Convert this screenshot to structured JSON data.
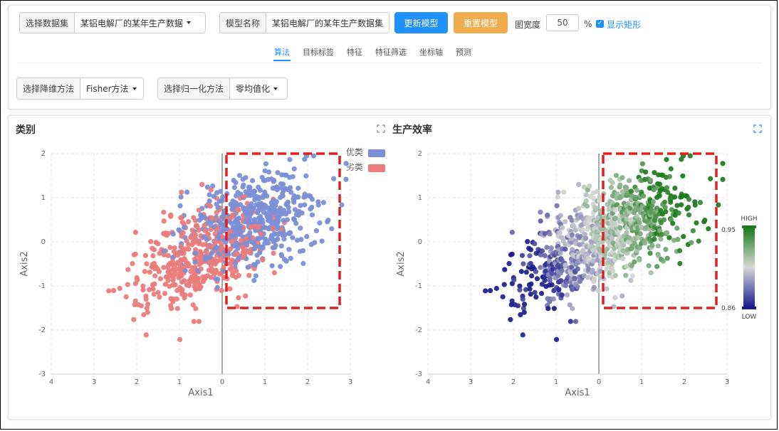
{
  "toolbar": {
    "dataset_label": "选择数据集",
    "dataset_value": "某铝电解厂的某年生产数据",
    "model_label": "模型名称",
    "model_value": "某铝电解厂的某年生产数据集",
    "update_button": "更新模型",
    "reset_button": "重置模型",
    "width_label": "图宽度",
    "width_value": "50",
    "width_unit": "%",
    "show_rect_label": "显示矩形",
    "show_rect_checked": true
  },
  "tabs": [
    {
      "label": "算法",
      "active": true
    },
    {
      "label": "目标标签",
      "active": false
    },
    {
      "label": "特征",
      "active": false
    },
    {
      "label": "特征筛选",
      "active": false
    },
    {
      "label": "坐标轴",
      "active": false
    },
    {
      "label": "预测",
      "active": false
    }
  ],
  "options": {
    "reduction_label": "选择降维方法",
    "reduction_value": "Fisher方法",
    "normalize_label": "选择归一化方法",
    "normalize_value": "零均值化"
  },
  "colors": {
    "accent": "#1e90ff",
    "reset": "#f0ad4e",
    "class_good": "#7b8fd6",
    "class_bad": "#ec7b7b",
    "rect": "#e02020",
    "scale_high": "#1a7a1a",
    "scale_mid": "#d8d8d8",
    "scale_low": "#1a1a8c"
  },
  "chart_data": [
    {
      "type": "scatter",
      "title": "类别",
      "xlabel": "Axis1",
      "ylabel": "Axis2",
      "xlim": [
        -4,
        3
      ],
      "ylim": [
        -3,
        2
      ],
      "x_ticks": [
        "4",
        "3",
        "2",
        "1",
        "0",
        "1",
        "2",
        "3"
      ],
      "y_ticks": [
        "2",
        "1",
        "0",
        "-1",
        "-2",
        "-3"
      ],
      "grid": true,
      "legend_position": "top-right",
      "series": [
        {
          "name": "优类",
          "color": "#7b8fd6",
          "count": 520,
          "center": [
            0.7,
            0.5
          ],
          "spread": [
            0.75,
            0.55
          ],
          "correlation": 0.35
        },
        {
          "name": "劣类",
          "color": "#ec7b7b",
          "count": 430,
          "center": [
            -0.6,
            -0.3
          ],
          "spread": [
            0.8,
            0.6
          ],
          "correlation": 0.45
        }
      ],
      "highlight_rect": {
        "x": [
          0.1,
          2.75
        ],
        "y": [
          -1.5,
          2.0
        ],
        "color": "#e02020",
        "dashed": true
      }
    },
    {
      "type": "scatter",
      "title": "生产效率",
      "xlabel": "Axis1",
      "ylabel": "Axis2",
      "xlim": [
        -4,
        3
      ],
      "ylim": [
        -3,
        2
      ],
      "x_ticks": [
        "4",
        "3",
        "2",
        "1",
        "0",
        "1",
        "2",
        "3"
      ],
      "y_ticks": [
        "2",
        "1",
        "0",
        "-1",
        "-2",
        "-3"
      ],
      "grid": true,
      "colorbar": {
        "high_label": "HIGH",
        "low_label": "LOW",
        "max": "0.95",
        "min": "0.86"
      },
      "highlight_rect": {
        "x": [
          0.1,
          2.75
        ],
        "y": [
          -1.5,
          2.0
        ],
        "color": "#e02020",
        "dashed": true
      }
    }
  ]
}
